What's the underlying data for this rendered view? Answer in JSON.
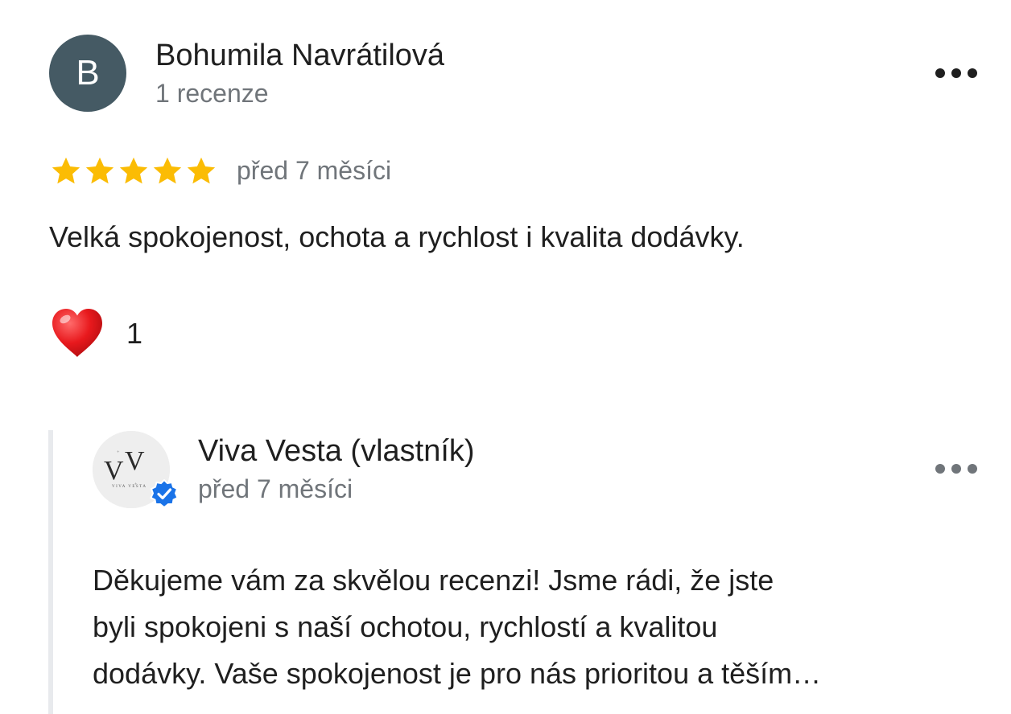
{
  "review": {
    "avatar_letter": "B",
    "avatar_color": "#455a64",
    "reviewer_name": "Bohumila Navrátilová",
    "reviewer_meta": "1 recenze",
    "more_icon": "more-horizontal-icon",
    "rating": 5,
    "rating_max": 5,
    "star_color": "#fbbc04",
    "date": "před 7 měsíci",
    "text": "Velká spokojenost, ochota a rychlost i kvalita dodávky.",
    "reaction_icon": "heart-icon",
    "reaction_count": "1"
  },
  "owner_reply": {
    "logo_letters": "VV",
    "logo_subtext": "VIVA VESTA",
    "verified_icon": "verified-badge-icon",
    "verified_color": "#1a73e8",
    "name": "Viva Vesta (vlastník)",
    "date": "před 7 měsíci",
    "more_icon": "more-horizontal-icon",
    "text_lines": [
      "Děkujeme vám za skvělou recenzi! Jsme rádi, že jste",
      "byli spokojeni s naší ochotou, rychlostí a kvalitou",
      "dodávky. Vaše spokojenost je pro nás prioritou a těším…"
    ]
  }
}
